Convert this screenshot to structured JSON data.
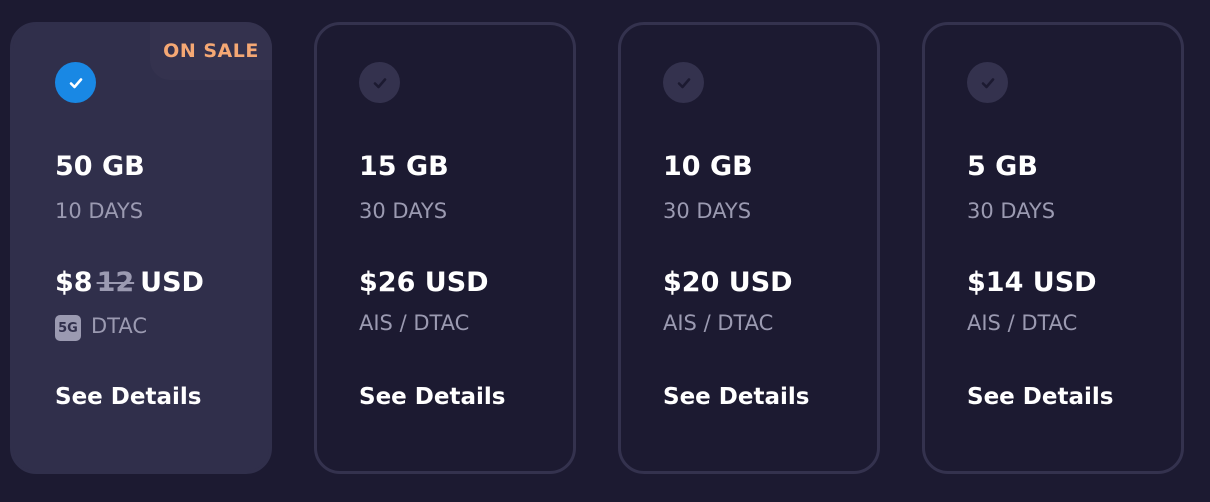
{
  "plans": [
    {
      "selected": true,
      "sale_label": "ON SALE",
      "data_amount": "50 GB",
      "duration": "10 DAYS",
      "price": "$8",
      "old_price": "12",
      "currency": "USD",
      "badge": "5G",
      "network": "DTAC",
      "details_label": "See Details"
    },
    {
      "selected": false,
      "data_amount": "15 GB",
      "duration": "30 DAYS",
      "price": "$26",
      "currency": "USD",
      "network": "AIS / DTAC",
      "details_label": "See Details"
    },
    {
      "selected": false,
      "data_amount": "10 GB",
      "duration": "30 DAYS",
      "price": "$20",
      "currency": "USD",
      "network": "AIS / DTAC",
      "details_label": "See Details"
    },
    {
      "selected": false,
      "data_amount": "5 GB",
      "duration": "30 DAYS",
      "price": "$14",
      "currency": "USD",
      "network": "AIS / DTAC",
      "details_label": "See Details"
    }
  ],
  "colors": {
    "background": "#1c1a31",
    "selected_card": "#302f4b",
    "card_border": "#34324e",
    "accent_check": "#1988e4",
    "sale_text": "#f5a874",
    "muted_text": "#9b9ab1"
  },
  "icons": {
    "check": "checkmark-icon",
    "network_badge": "5g-badge-icon"
  }
}
